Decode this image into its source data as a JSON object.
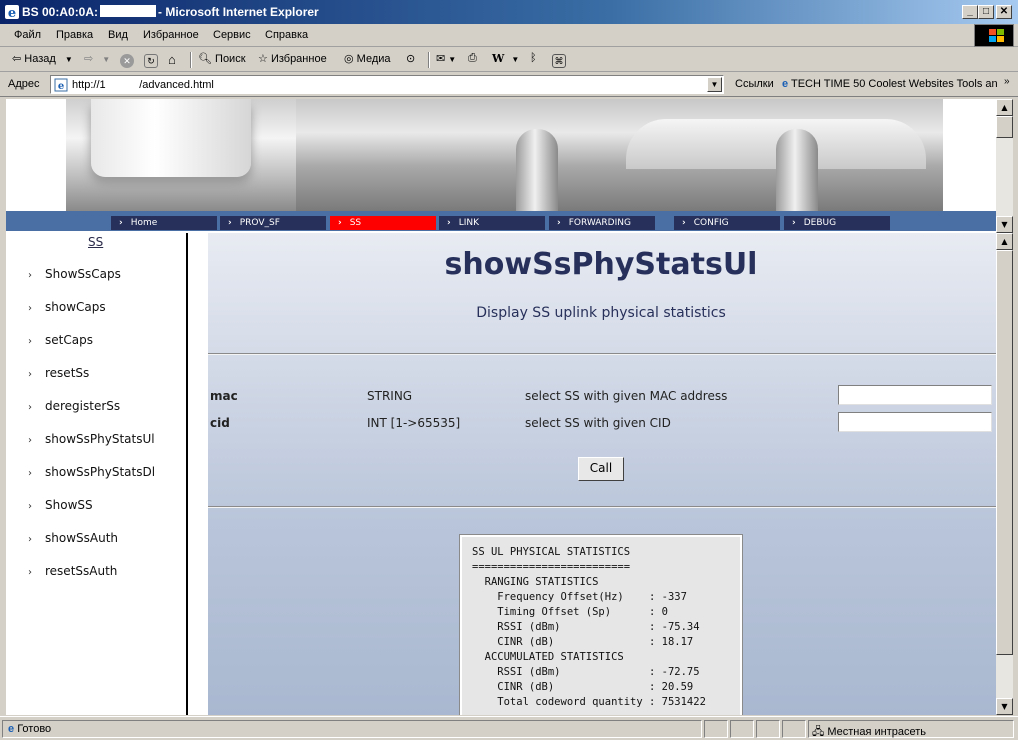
{
  "window": {
    "title_prefix": "BS 00:A0:0A:",
    "title_suffix": "- Microsoft Internet Explorer",
    "minimize": "_",
    "maximize": "□",
    "close": "✕"
  },
  "menu": [
    "Файл",
    "Правка",
    "Вид",
    "Избранное",
    "Сервис",
    "Справка"
  ],
  "toolbar": {
    "back_label": "Назад",
    "search_label": "Поиск",
    "favorites_label": "Избранное",
    "media_label": "Медиа"
  },
  "address": {
    "label": "Адрес",
    "url": "http://1           /advanced.html",
    "links_label": "Ссылки",
    "links_item": "TECH TIME 50 Coolest Websites Tools an"
  },
  "nav": {
    "items": [
      "Home",
      "PROV_SF",
      "SS",
      "LINK",
      "FORWARDING",
      "CONFIG",
      "DEBUG"
    ],
    "active": "SS"
  },
  "sidebar": {
    "title": "SS",
    "items": [
      "ShowSsCaps",
      "showCaps",
      "setCaps",
      "resetSs",
      "deregisterSs",
      "showSsPhyStatsUl",
      "showSsPhyStatsDl",
      "ShowSS",
      "showSsAuth",
      "resetSsAuth"
    ]
  },
  "main": {
    "title": "showSsPhyStatsUl",
    "description": "Display SS uplink physical statistics",
    "params": [
      {
        "name": "mac",
        "type": "STRING",
        "desc": "select SS with given MAC address"
      },
      {
        "name": "cid",
        "type": "INT [1->65535]",
        "desc": "select SS with given CID"
      }
    ],
    "call_label": "Call",
    "output": "SS UL PHYSICAL STATISTICS\n=========================\n  RANGING STATISTICS\n    Frequency Offset(Hz)    : -337\n    Timing Offset (Sp)      : 0\n    RSSI (dBm)              : -75.34\n    CINR (dB)               : 18.17\n  ACCUMULATED STATISTICS\n    RSSI (dBm)              : -72.75\n    CINR (dB)               : 20.59\n    Total codeword quantity : 7531422"
  },
  "status": {
    "text": "Готово",
    "zone": "Местная интрасеть"
  },
  "colors": {
    "nav_bg": "#4a6fa5",
    "nav_item": "#27305a",
    "nav_active": "#ff0000",
    "title_color": "#27305a"
  }
}
